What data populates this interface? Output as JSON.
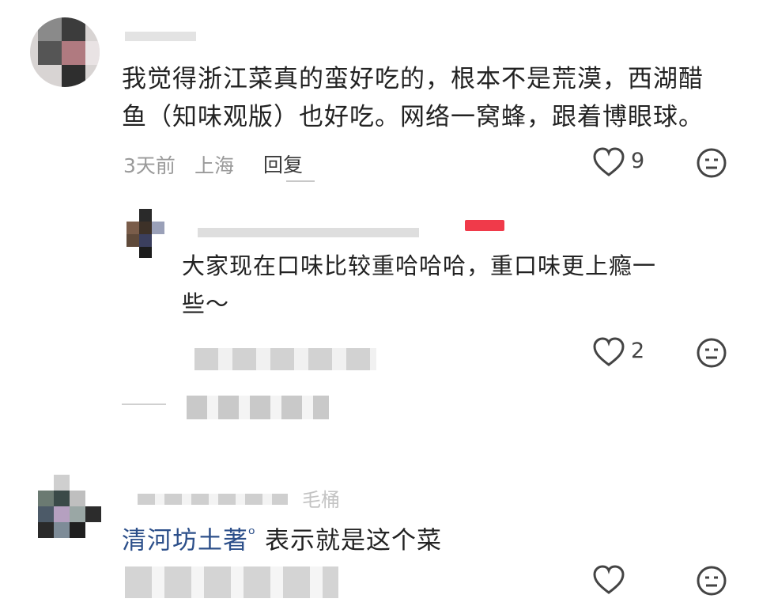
{
  "comments": [
    {
      "text": "我觉得浙江菜真的蛮好吃的，根本不是荒漠，西湖醋鱼（知味观版）也好吃。网络一窝蜂，跟着博眼球。",
      "line1": "我觉得浙江菜真的蛮好吃的，根本不是荒漠，西湖醋",
      "line2": "鱼（知味观版）也好吃。网络一窝蜂，跟着博眼球。",
      "time": "3天前",
      "location": "上海",
      "reply_label": "回复",
      "like_count": "9"
    },
    {
      "line1": "大家现在口味比较重哈哈哈，重口味更上瘾一",
      "line2": "些～",
      "like_count": "2"
    },
    {
      "partial_name": "毛桶",
      "mention": "清河坊土著",
      "mention_badge": "ᵒ",
      "text": "表示就是这个菜"
    }
  ],
  "icons": {
    "like": "heart-outline-icon",
    "dislike": "neutral-face-icon"
  },
  "colors": {
    "accent_red": "#f03a4a",
    "mention_blue": "#2c4f8a",
    "meta_gray": "#9a9a9a"
  }
}
